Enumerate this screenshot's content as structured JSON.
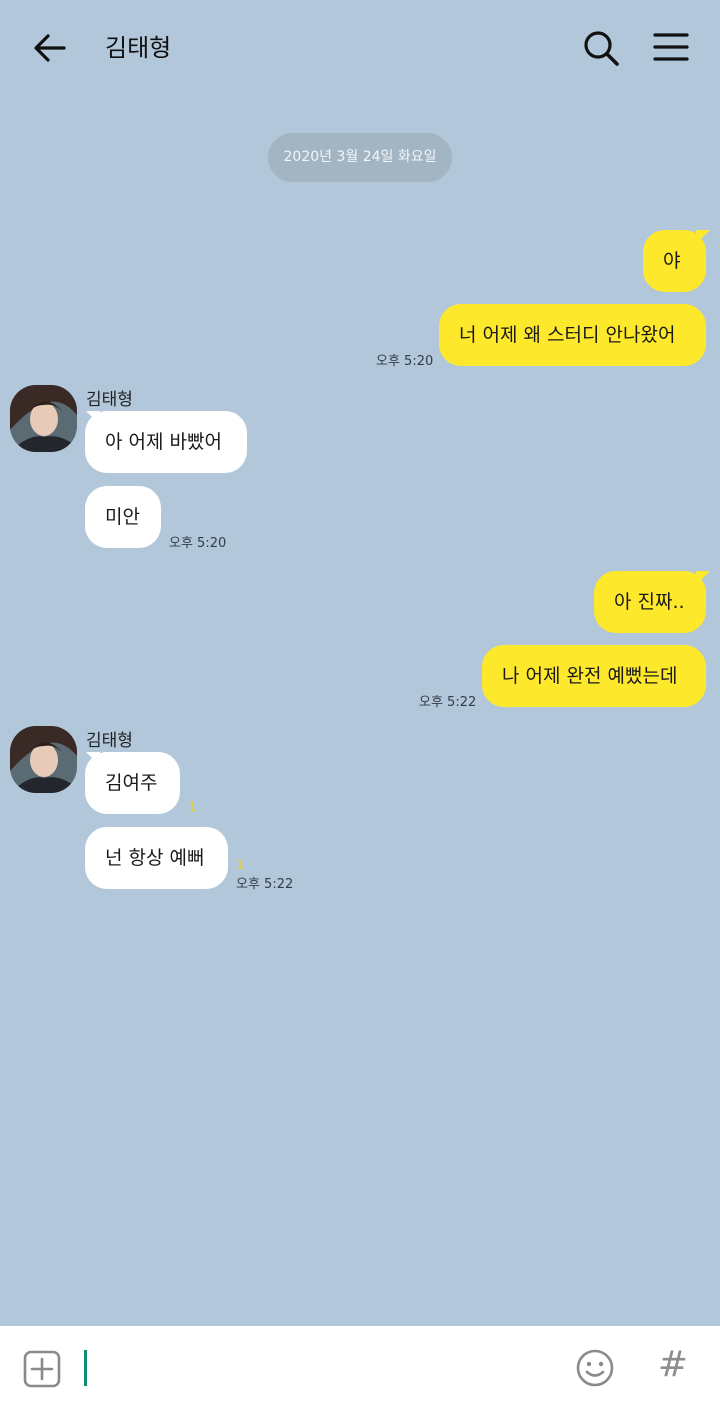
{
  "header": {
    "title": "김태형",
    "back_icon": "arrow-left-icon",
    "search_icon": "search-icon",
    "menu_icon": "hamburger-menu-icon"
  },
  "date_separator": "2020년 3월 24일 화요일",
  "messages": [
    {
      "from": "me",
      "text": "야"
    },
    {
      "from": "me",
      "text": "너 어제 왜 스터디 안나왔어",
      "time": "오후 5:20"
    },
    {
      "from": "other",
      "sender": "김태형",
      "text": "아 어제 바빴어"
    },
    {
      "from": "other",
      "text": "미안",
      "time": "오후 5:20"
    },
    {
      "from": "me",
      "text": "아 진짜.."
    },
    {
      "from": "me",
      "text": "나 어제 완전 예뻤는데",
      "time": "오후 5:22"
    },
    {
      "from": "other",
      "sender": "김태형",
      "text": "김여주",
      "unread": "1"
    },
    {
      "from": "other",
      "text": "넌 항상 예뻐",
      "unread": "1",
      "time": "오후 5:22"
    }
  ],
  "input": {
    "value": "",
    "placeholder": "",
    "plus_icon": "plus-square-icon",
    "emoji_icon": "smiley-icon",
    "hash_label": "#"
  },
  "colors": {
    "background": "#b2c7da",
    "my_bubble": "#fee82b",
    "other_bubble": "#ffffff",
    "date_pill": "#a3b4c3",
    "cursor": "#0f8a73"
  }
}
